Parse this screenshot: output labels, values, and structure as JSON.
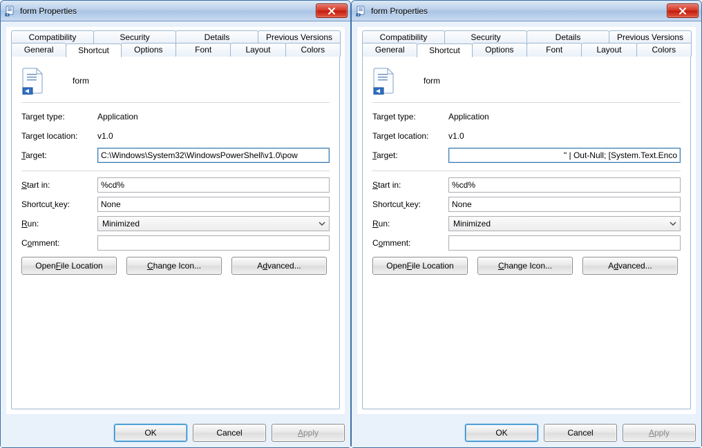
{
  "windows": [
    {
      "title": "form Properties",
      "tabsRow1": [
        "Compatibility",
        "Security",
        "Details",
        "Previous Versions"
      ],
      "tabsRow2": [
        "General",
        "Shortcut",
        "Options",
        "Font",
        "Layout",
        "Colors"
      ],
      "activeTab": "Shortcut",
      "fileName": "form",
      "targetTypeLabel": "Target type:",
      "targetTypeValue": "Application",
      "targetLocationLabel": "Target location:",
      "targetLocationValue": "v1.0",
      "targetLabel": "Target:",
      "targetLabelUnderlineIndex": 0,
      "targetValue": "C:\\Windows\\System32\\WindowsPowerShell\\v1.0\\pow",
      "targetAlignRight": false,
      "startInLabel": "Start in:",
      "startInUnderlineIndex": 0,
      "startInValue": "%cd%",
      "shortcutKeyLabel": "Shortcut key:",
      "shortcutKeyUnderlineIndex": 8,
      "shortcutKeyValue": "None",
      "runLabel": "Run:",
      "runUnderlineIndex": 0,
      "runValue": "Minimized",
      "commentLabel": "Comment:",
      "commentUnderlineIndex": 1,
      "commentValue": "",
      "openFileLocation": "Open File Location",
      "openFileLocationUL": 5,
      "changeIcon": "Change Icon...",
      "changeIconUL": 0,
      "advanced": "Advanced...",
      "advancedUL": 1,
      "ok": "OK",
      "cancel": "Cancel",
      "apply": "Apply",
      "applyUL": 0
    },
    {
      "title": "form Properties",
      "tabsRow1": [
        "Compatibility",
        "Security",
        "Details",
        "Previous Versions"
      ],
      "tabsRow2": [
        "General",
        "Shortcut",
        "Options",
        "Font",
        "Layout",
        "Colors"
      ],
      "activeTab": "Shortcut",
      "fileName": "form",
      "targetTypeLabel": "Target type:",
      "targetTypeValue": "Application",
      "targetLocationLabel": "Target location:",
      "targetLocationValue": "v1.0",
      "targetLabel": "Target:",
      "targetLabelUnderlineIndex": 0,
      "targetValue": "\" | Out-Null; [System.Text.Enco",
      "targetAlignRight": true,
      "startInLabel": "Start in:",
      "startInUnderlineIndex": 0,
      "startInValue": "%cd%",
      "shortcutKeyLabel": "Shortcut key:",
      "shortcutKeyUnderlineIndex": 8,
      "shortcutKeyValue": "None",
      "runLabel": "Run:",
      "runUnderlineIndex": 0,
      "runValue": "Minimized",
      "commentLabel": "Comment:",
      "commentUnderlineIndex": 1,
      "commentValue": "",
      "openFileLocation": "Open File Location",
      "openFileLocationUL": 5,
      "changeIcon": "Change Icon...",
      "changeIconUL": 0,
      "advanced": "Advanced...",
      "advancedUL": 1,
      "ok": "OK",
      "cancel": "Cancel",
      "apply": "Apply",
      "applyUL": 0
    }
  ]
}
